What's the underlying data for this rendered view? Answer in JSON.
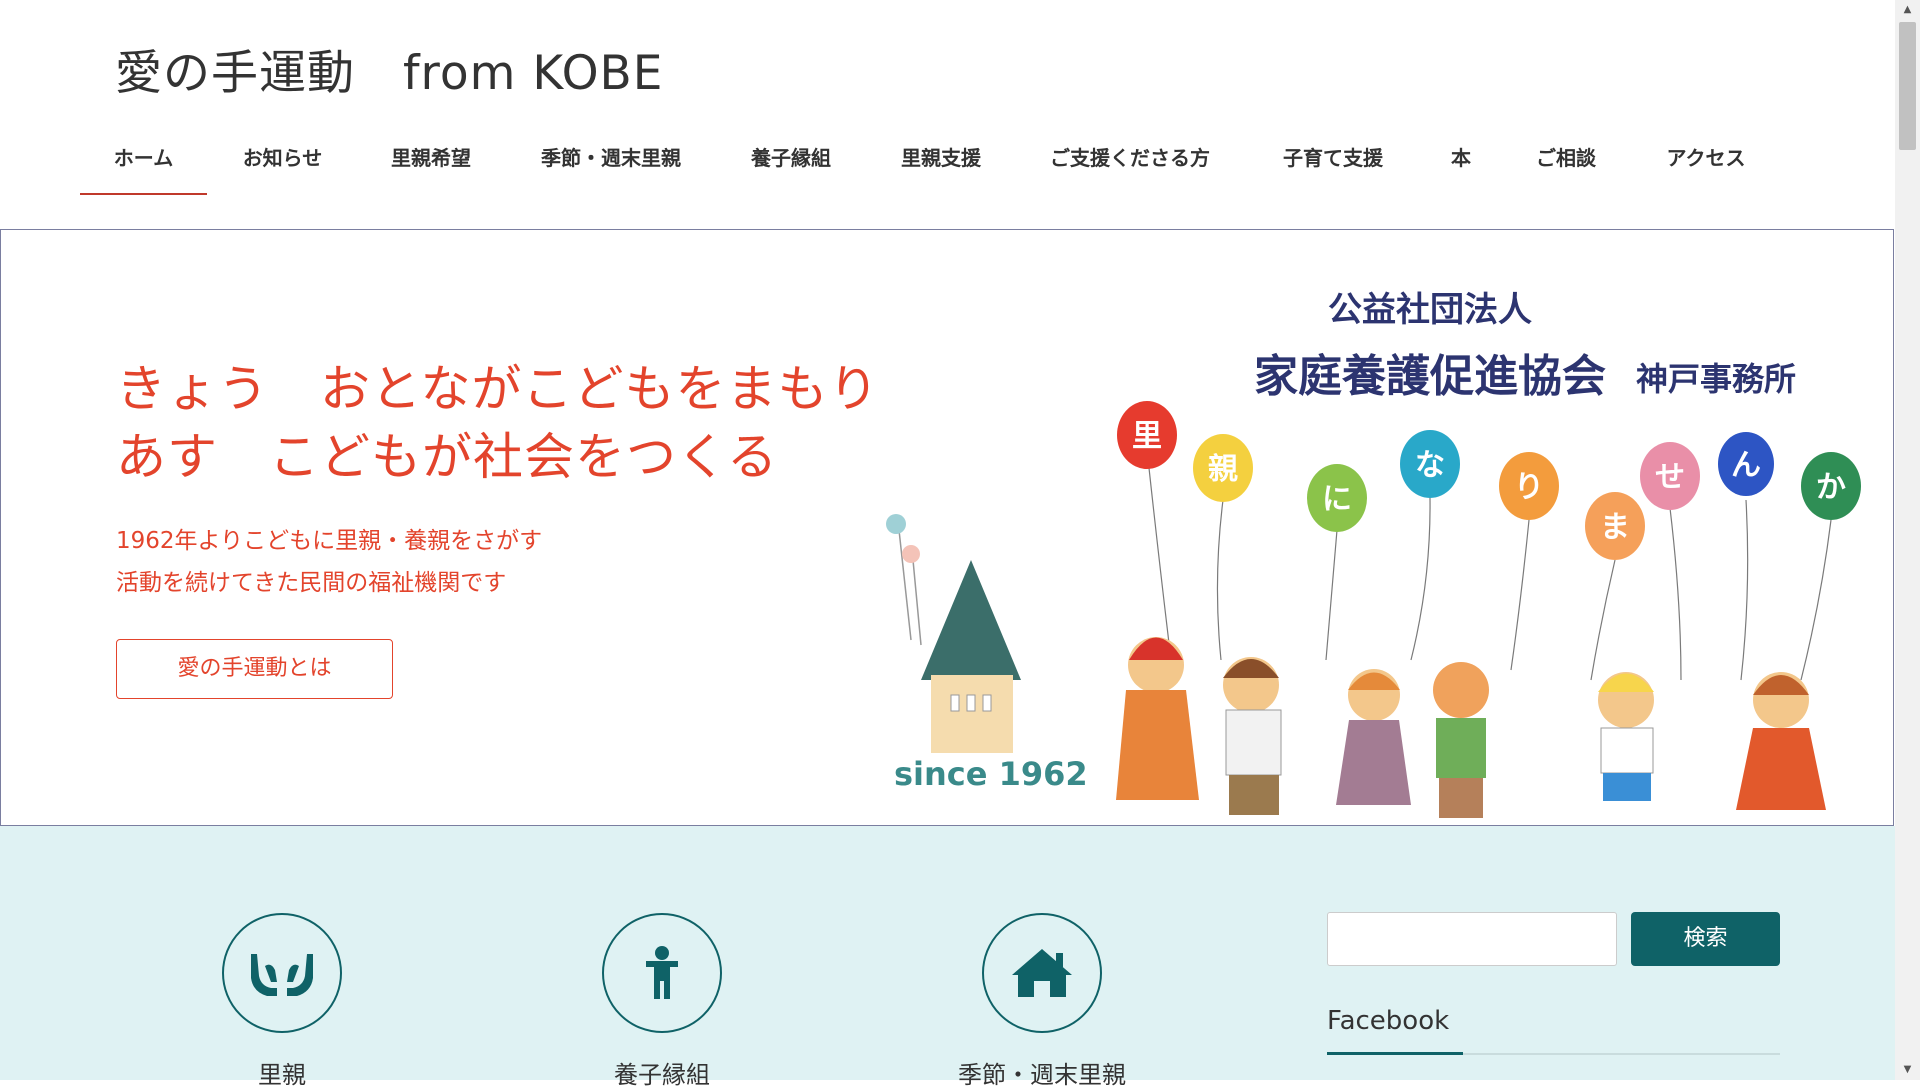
{
  "site": {
    "title": "愛の手運動　from KOBE"
  },
  "nav": {
    "items": [
      {
        "label": "ホーム",
        "active": true
      },
      {
        "label": "お知らせ"
      },
      {
        "label": "里親希望"
      },
      {
        "label": "季節・週末里親"
      },
      {
        "label": "養子縁組"
      },
      {
        "label": "里親支援"
      },
      {
        "label": "ご支援くださる方"
      },
      {
        "label": "子育て支援"
      },
      {
        "label": "本"
      },
      {
        "label": "ご相談"
      },
      {
        "label": "アクセス"
      }
    ]
  },
  "hero": {
    "tagline_line1": "きょう　おとながこどもをまもり",
    "tagline_line2": "あす　こどもが社会をつくる",
    "subtext_line1": "1962年よりこどもに里親・養親をさがす",
    "subtext_line2": "活動を続けてきた民間の福祉機関です",
    "button_label": "愛の手運動とは",
    "org_line1": "公益社団法人",
    "org_line2": "家庭養護促進協会",
    "org_line3": "神戸事務所",
    "since": "since 1962",
    "balloons": [
      "里",
      "親",
      "に",
      "な",
      "り",
      "ま",
      "せ",
      "ん",
      "か"
    ],
    "accent_color": "#e3442c",
    "org_color": "#2c3470"
  },
  "features": [
    {
      "label": "里親",
      "icon": "hands-icon"
    },
    {
      "label": "養子縁組",
      "icon": "person-icon"
    },
    {
      "label": "季節・週末里親",
      "icon": "home-icon"
    }
  ],
  "sidebar": {
    "search_button": "検索",
    "facebook_title": "Facebook"
  },
  "colors": {
    "teal": "#0f6267",
    "lower_bg": "#dff2f3"
  }
}
